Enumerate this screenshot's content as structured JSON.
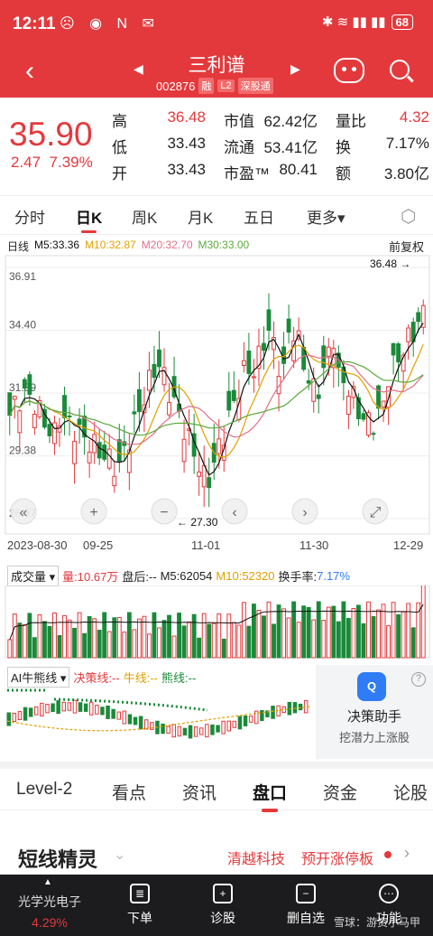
{
  "status": {
    "time": "12:11",
    "notif_icons": "☹ ◉ N ✉",
    "signal": "✱ ≋ ▮▮ ▮▮",
    "battery": "68"
  },
  "header": {
    "stock_name": "三利谱",
    "code": "002876",
    "tags": [
      "融",
      "L2",
      "深股通"
    ]
  },
  "quote": {
    "price": "35.90",
    "change": "2.47",
    "change_pct": "7.39%",
    "fields": [
      {
        "label": "高",
        "value": "36.48"
      },
      {
        "label": "市值",
        "value": "62.42亿"
      },
      {
        "label": "量比",
        "value": "4.32"
      },
      {
        "label": "低",
        "value": "33.43"
      },
      {
        "label": "流通",
        "value": "53.41亿"
      },
      {
        "label": "换",
        "value": "7.17%"
      },
      {
        "label": "开",
        "value": "33.43"
      },
      {
        "label": "市盈™",
        "value": "80.41"
      },
      {
        "label": "额",
        "value": "3.80亿"
      }
    ]
  },
  "period_tabs": [
    "分时",
    "日K",
    "周K",
    "月K",
    "五日",
    "更多▾"
  ],
  "active_period": "日K",
  "ma_legend": {
    "title": "日线",
    "m5": "M5:33.36",
    "m10": "M10:32.87",
    "m20": "M20:32.70",
    "m30": "M30:33.00",
    "adjust": "前复权"
  },
  "colors": {
    "up": "#e4393c",
    "down": "#1a8a3a",
    "m5": "#111111",
    "m10": "#e0a000",
    "m20": "#e0708a",
    "m30": "#5aaa3a"
  },
  "chart_data": {
    "type": "candlestick",
    "y_ticks": [
      "36.91",
      "34.40",
      "31.89",
      "29.38",
      "26.87"
    ],
    "ylim": [
      26.87,
      36.91
    ],
    "x_ticks": [
      "2023-08-30",
      "09-25",
      "11-01",
      "11-30",
      "12-29"
    ],
    "max_label": "36.48",
    "min_label": "27.30",
    "chart_controls": [
      "«",
      "+",
      "−",
      "‹",
      "›",
      "⤢"
    ]
  },
  "volume": {
    "selector": "成交量",
    "qty": "量:10.67万",
    "after": "盘后:--",
    "m5": "M5:62054",
    "m10": "M10:52320",
    "turnover_label": "换手率:",
    "turnover": "7.17%"
  },
  "ai": {
    "selector": "AI牛熊线",
    "decision": "决策线:--",
    "bull": "牛线:--",
    "bear": "熊线:--"
  },
  "assistant": {
    "logo": "Q",
    "title": "决策助手",
    "subtitle": "挖潜力上涨股",
    "help": "?"
  },
  "bottom_tabs": [
    "Level-2",
    "看点",
    "资讯",
    "盘口",
    "资金",
    "论股"
  ],
  "active_bottom_tab": "盘口",
  "short_line": {
    "title": "短线精灵",
    "chevron": "⌄",
    "item1": "清越科技",
    "item2": "预开涨停板",
    "arrow": "›"
  },
  "nav": {
    "stock_name": "光学光电子",
    "stock_pct": "4.29%",
    "caret": "▲",
    "items": [
      {
        "icon": "≣",
        "label": "下单"
      },
      {
        "icon": "+",
        "label": "诊股"
      },
      {
        "icon": "−",
        "label": "删自选"
      },
      {
        "icon": "⋯",
        "label": "功能"
      }
    ]
  },
  "watermark": "雪球：游资小马甲"
}
